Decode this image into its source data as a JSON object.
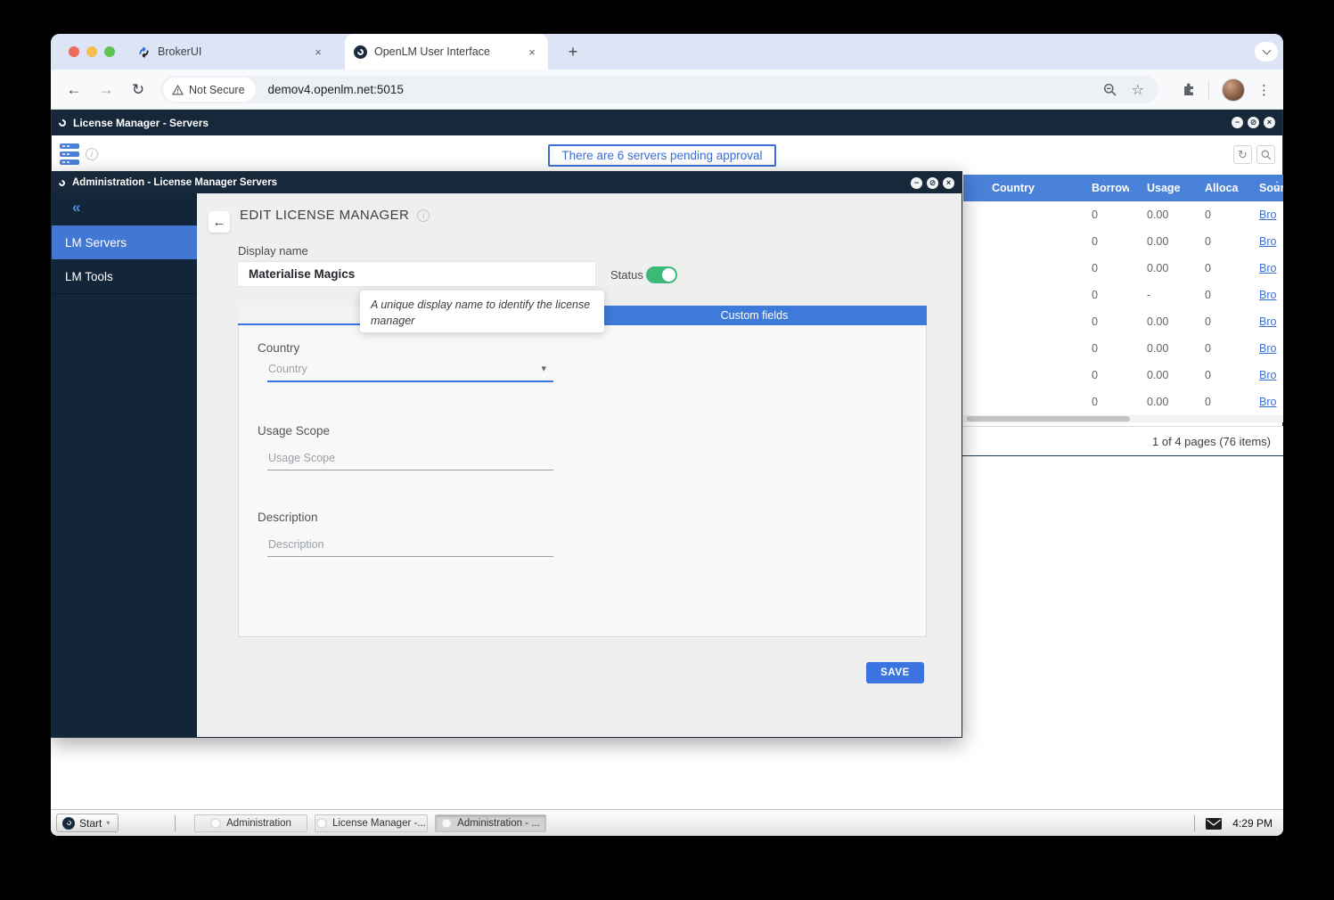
{
  "browser": {
    "tab1": "BrokerUI",
    "tab2": "OpenLM User Interface",
    "close_glyph": "×",
    "new_tab_glyph": "+",
    "not_secure": "Not Secure",
    "url": "demov4.openlm.net:5015"
  },
  "lm_window": {
    "title": "License Manager - Servers",
    "notification": "There are 6 servers pending approval",
    "table": {
      "headers": {
        "country": "Country",
        "borrow": "Borrow",
        "usage": "Usage",
        "allocated": "Alloca",
        "source": "Sour"
      },
      "rows": [
        {
          "borrow": "0",
          "usage": "0.00",
          "allocated": "0",
          "source": "Bro"
        },
        {
          "borrow": "0",
          "usage": "0.00",
          "allocated": "0",
          "source": "Bro"
        },
        {
          "borrow": "0",
          "usage": "0.00",
          "allocated": "0",
          "source": "Bro"
        },
        {
          "borrow": "0",
          "usage": "-",
          "allocated": "0",
          "source": "Bro"
        },
        {
          "borrow": "0",
          "usage": "0.00",
          "allocated": "0",
          "source": "Bro"
        },
        {
          "borrow": "0",
          "usage": "0.00",
          "allocated": "0",
          "source": "Bro"
        },
        {
          "borrow": "0",
          "usage": "0.00",
          "allocated": "0",
          "source": "Bro"
        },
        {
          "borrow": "0",
          "usage": "0.00",
          "allocated": "0",
          "source": "Bro"
        }
      ],
      "pagination": "1 of 4 pages (76 items)"
    }
  },
  "admin": {
    "title": "Administration - License Manager Servers",
    "sidebar": {
      "collapse": "«",
      "lm_servers": "LM Servers",
      "lm_tools": "LM Tools"
    },
    "form": {
      "back_glyph": "←",
      "heading": "EDIT LICENSE MANAGER",
      "display_name_label": "Display name",
      "display_name_value": "Materialise Magics",
      "status_label": "Status",
      "tooltip": "A unique display name to identify the license manager",
      "custom_fields_tab": "Custom fields",
      "country_label": "Country",
      "country_placeholder": "Country",
      "usage_scope_label": "Usage Scope",
      "usage_scope_placeholder": "Usage Scope",
      "description_label": "Description",
      "description_placeholder": "Description",
      "save": "SAVE"
    }
  },
  "window_controls": {
    "minimize": "−",
    "maximize": "⊘",
    "close": "×"
  },
  "taskbar": {
    "start": "Start",
    "item1": "Administration",
    "item2": "License Manager -...",
    "item3": "Administration - ...",
    "time": "4:29 PM"
  },
  "colors": {
    "navy": "#16283a",
    "accent_blue": "#3b74e0",
    "header_blue": "#4a81d9",
    "sidebar_active": "#4377d4",
    "toggle_green": "#3cb878",
    "notification_blue": "#3b6fd4"
  }
}
